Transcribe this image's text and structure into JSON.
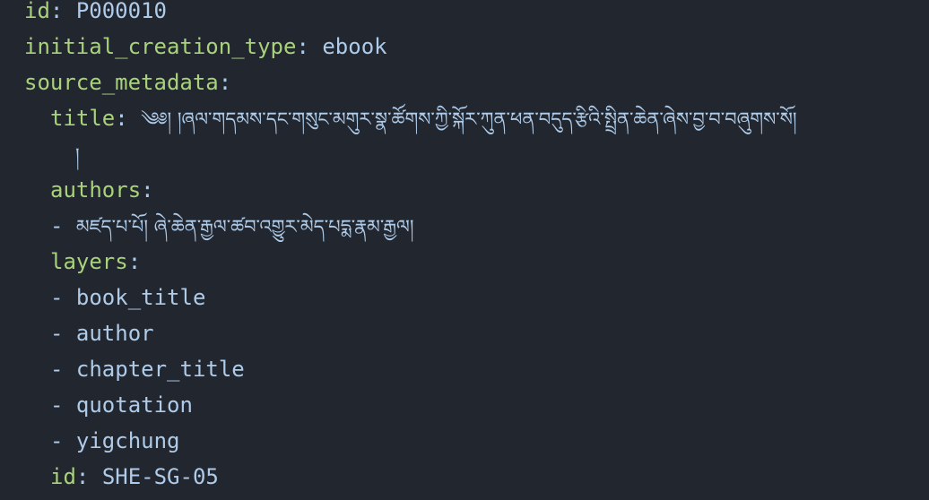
{
  "yaml": {
    "id_key": "id",
    "id_value": "P000010",
    "initial_creation_type_key": "initial_creation_type",
    "initial_creation_type_value": "ebook",
    "source_metadata_key": "source_metadata",
    "source_metadata": {
      "title_key": "title",
      "title_value": "༄༅། །ཞལ་གདམས་དང་གསུང་མགུར་སྣ་ཚོགས་ཀྱི་སྐོར་ཀུན་ཕན་བདུད་རྩིའི་སྤྲིན་ཆེན་ཞེས་བྱ་བ་བཞུགས་སོ།",
      "title_continuation": "།",
      "authors_key": "authors",
      "authors": [
        "མཛད་པ་པོ། ཞེ་ཆེན་རྒྱལ་ཚབ་འགྱུར་མེད་པདྨ་རྣམ་རྒྱལ།"
      ],
      "layers_key": "layers",
      "layers": [
        "book_title",
        "author",
        "chapter_title",
        "quotation",
        "yigchung"
      ],
      "id_key": "id",
      "id_value": "SHE-SG-05"
    }
  },
  "colors": {
    "background": "#22262e",
    "key": "#a8d27b",
    "value": "#aecbea"
  }
}
